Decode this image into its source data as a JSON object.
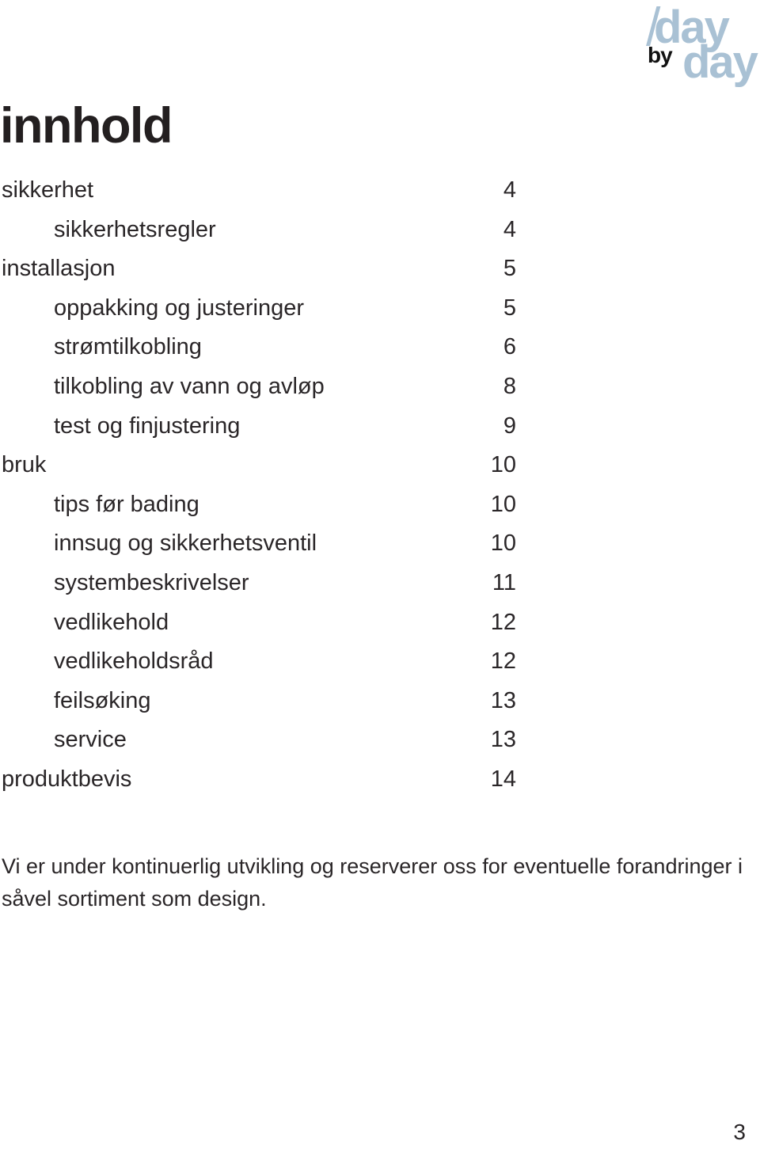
{
  "logo": {
    "top_word": "day",
    "by_word": "by",
    "bottom_word": "day",
    "accent_color": "#a9c1d4",
    "by_color": "#111111"
  },
  "header": {
    "title": "innhold"
  },
  "toc": {
    "entries": [
      {
        "label": "sikkerhet",
        "page": "4",
        "level": 1
      },
      {
        "label": "sikkerhetsregler",
        "page": "4",
        "level": 2
      },
      {
        "label": "installasjon",
        "page": "5",
        "level": 1
      },
      {
        "label": "oppakking og justeringer",
        "page": "5",
        "level": 2
      },
      {
        "label": "strømtilkobling",
        "page": "6",
        "level": 2
      },
      {
        "label": "tilkobling av vann og avløp",
        "page": "8",
        "level": 2
      },
      {
        "label": "test og finjustering",
        "page": "9",
        "level": 2
      },
      {
        "label": "bruk",
        "page": "10",
        "level": 1
      },
      {
        "label": "tips før bading",
        "page": "10",
        "level": 2
      },
      {
        "label": "innsug og sikkerhetsventil",
        "page": "10",
        "level": 2
      },
      {
        "label": "systembeskrivelser",
        "page": "11",
        "level": 2
      },
      {
        "label": "vedlikehold",
        "page": "12",
        "level": 2
      },
      {
        "label": "vedlikeholdsråd",
        "page": "12",
        "level": 2
      },
      {
        "label": "feilsøking",
        "page": "13",
        "level": 2
      },
      {
        "label": "service",
        "page": "13",
        "level": 2
      },
      {
        "label": "produktbevis",
        "page": "14",
        "level": 1
      }
    ]
  },
  "disclaimer": {
    "text": "Vi er under kontinuerlig utvikling og reserverer oss for eventuelle forandringer i såvel sortiment som design."
  },
  "footer": {
    "page_number": "3"
  }
}
